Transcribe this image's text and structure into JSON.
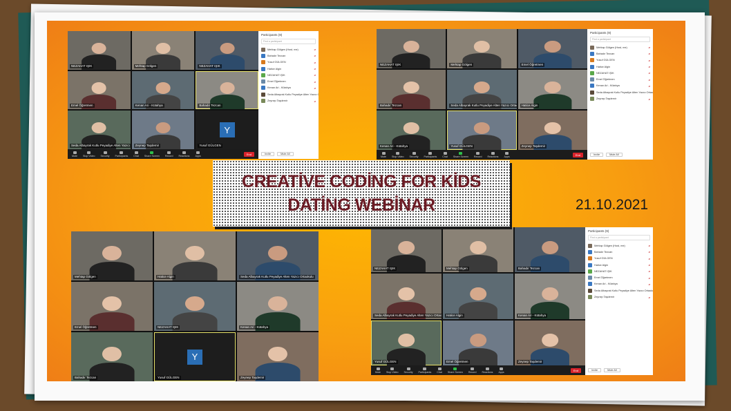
{
  "title": {
    "line1": "CREATİVE CODİNG FOR KİDS",
    "line2": "DATİNG WEBİNAR"
  },
  "date": "21.10.2021",
  "colors": {
    "accent_orange": "#f89e10",
    "title_text": "#6b1b24",
    "zoom_end": "#d9242c",
    "avatar_blue": "#2a6eb5"
  },
  "avatar_letter": "Y",
  "zoom_toolbar": [
    "Mute",
    "Stop Video",
    "Security",
    "Participants",
    "Chat",
    "Share Screen",
    "Record",
    "Reactions",
    "Apps"
  ],
  "end_label": "End",
  "participants_panel": {
    "title": "Participants (9)",
    "search_placeholder": "Find a participant",
    "invite": "Invite",
    "mute_all": "Mute All",
    "list": [
      "Mehtap Gölgen (Host, me)",
      "Bahadır Tezcan",
      "Yusuf GÜLGEN",
      "Hatice Algin",
      "NEZAHAT IŞIK",
      "Emel Öğretmen",
      "Kenan Ari - Kütahya",
      "Seda Albayrak Kutlu Peyadiye Alten Yazıcı Ortaokulu",
      "Zeynep Taşdemir"
    ]
  },
  "panels": {
    "p1": [
      "NEZAHAT IŞIK",
      "Mehtap Gölgen",
      "NEZAHAT IŞIK",
      "Emel Öğretmen",
      "Kenan Ari - Kütahya",
      "Bahadır Tezcan",
      "Seda Albayrak Kutlu Peyadiye Alten Yazıcı Ortaokulu",
      "Zeynep Taşdemir",
      "Yusuf GÜLGEN"
    ],
    "p2": [
      "NEZAHAT IŞIK",
      "Mehtap Gölgen",
      "Emel Öğretmen",
      "Bahadır Tezcan",
      "Seda Albayrak Kutlu Peyadiye Alten Yazıcı Ortaokulu",
      "Hatice Algin",
      "Kenan Ari - Kütahya",
      "Yusuf GÜLGEN",
      "Zeynep Taşdemir"
    ],
    "p3": [
      "Mehtap Gölgen",
      "Hatice Algin",
      "Seda Albayrak Kutlu Peyadiye Alten Yazıcı Ortaokulu",
      "Emel Öğretmen",
      "NEZAHAT IŞIK",
      "Kenan Ari - Kütahya",
      "Bahadır Tezcan",
      "Yusuf GÜLGEN",
      "Zeynep Taşdemir"
    ],
    "p4": [
      "NEZAHAT IŞIK",
      "Mehtap Gölgen",
      "Bahadır Tezcan",
      "Seda Albayrak Kutlu Peyadiye Alten Yazıcı Ortaokulu",
      "Hatice Algin",
      "Kenan Ari - Kütahya",
      "Yusuf GÜLGEN",
      "Emel Öğretmen",
      "Zeynep Taşdemir"
    ]
  }
}
